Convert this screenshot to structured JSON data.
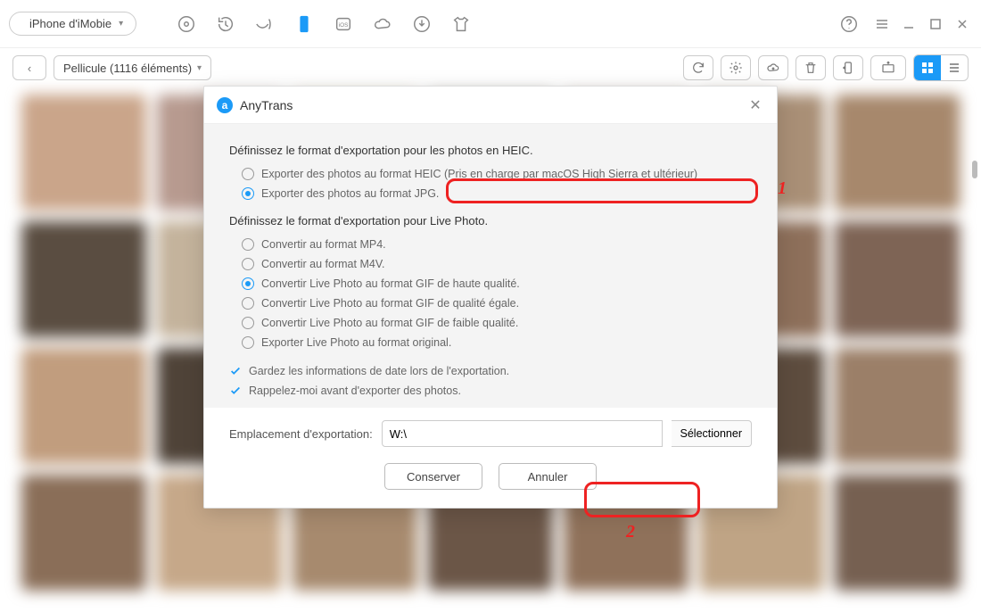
{
  "topbar": {
    "device_label": "iPhone d'iMobie"
  },
  "subbar": {
    "album_label": "Pellicule (1116 éléments)"
  },
  "modal": {
    "app_name": "AnyTrans",
    "heic_section_title": "Définissez le format d'exportation pour les photos en HEIC.",
    "heic_options": [
      "Exporter des photos au format HEIC (Pris en charge par macOS High Sierra et ultérieur)",
      "Exporter des photos au format JPG."
    ],
    "heic_selected_index": 1,
    "live_section_title": "Définissez le format d'exportation pour Live Photo.",
    "live_options": [
      "Convertir au format MP4.",
      "Convertir au format M4V.",
      "Convertir Live Photo au format GIF de haute qualité.",
      "Convertir Live Photo au format GIF de qualité égale.",
      "Convertir Live Photo au format GIF de faible qualité.",
      "Exporter Live Photo au format original."
    ],
    "live_selected_index": 2,
    "check1": "Gardez les informations de date lors de l'exportation.",
    "check2": "Rappelez-moi avant d'exporter des photos.",
    "export_label": "Emplacement d'exportation:",
    "export_path": "W:\\",
    "select_btn": "Sélectionner",
    "save_btn": "Conserver",
    "cancel_btn": "Annuler"
  },
  "annotations": {
    "one": "1",
    "two": "2"
  },
  "thumb_colors": [
    "#caa58a",
    "#b79a8f",
    "#b7a07a",
    "#7a705f",
    "#9c7e68",
    "#a98f76",
    "#a7886c",
    "#5a4d41",
    "#c4b39c",
    "#9e8e7a",
    "#b59a7e",
    "#6d5d4f",
    "#8d6f5a",
    "#7e6455",
    "#c19d7e",
    "#4f4338",
    "#b49578",
    "#6f5a4a",
    "#a28871",
    "#5d4c3e",
    "#9b7f68",
    "#8a6e58",
    "#c6a889",
    "#a78a6e",
    "#6b5647",
    "#8f715a",
    "#bfa485",
    "#766051"
  ]
}
